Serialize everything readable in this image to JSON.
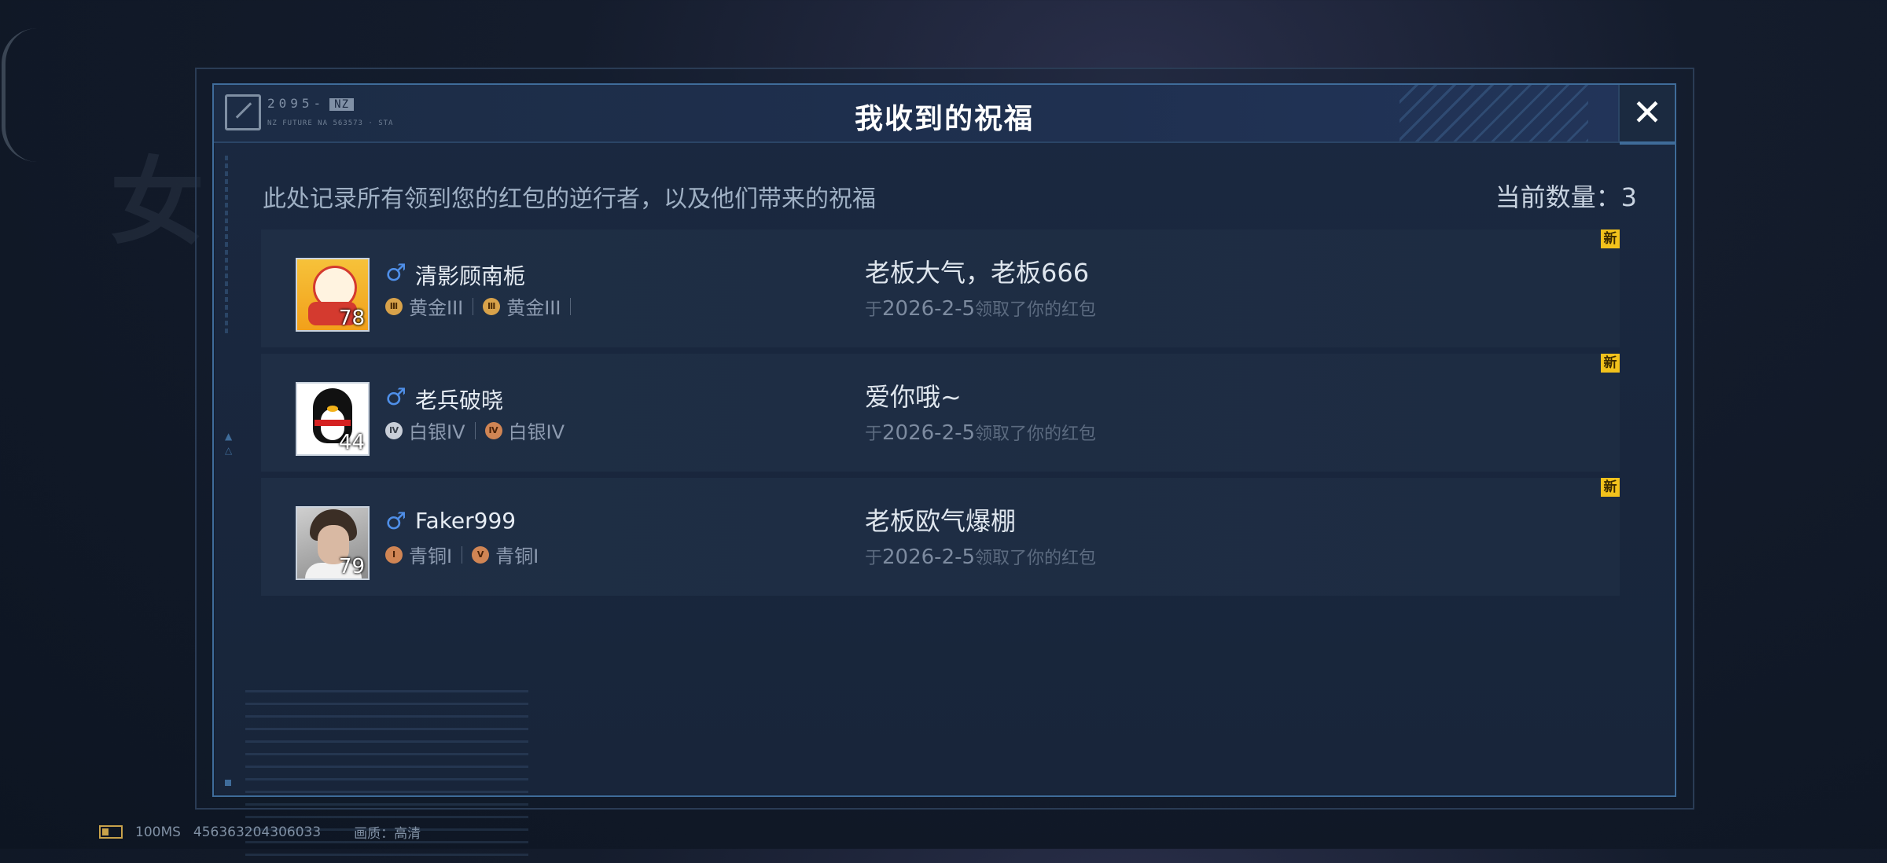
{
  "dialog": {
    "title": "我收到的祝福",
    "logo_code": "2095-",
    "logo_tag": "NZ",
    "logo_sub": "NZ FUTURE NA 563573 · STA",
    "close_label": "✕",
    "description": "此处记录所有领到您的红包的逆行者，以及他们带来的祝福",
    "count_text": "当前数量：3"
  },
  "entries": [
    {
      "name": "清影顾南栀",
      "gender": "♂",
      "level": "78",
      "rank1_icon": "Ⅲ",
      "rank1": "黄金III",
      "rank2_icon": "Ⅲ",
      "rank2": "黄金III",
      "blessing": "老板大气，老板666",
      "prefix": "于",
      "date": "2026-2-5",
      "suffix": "领取了你的红包",
      "badge": "新"
    },
    {
      "name": "老兵破晓",
      "gender": "♂",
      "level": "44",
      "rank1_icon": "Ⅳ",
      "rank1": "白银IV",
      "rank2_icon": "Ⅳ",
      "rank2": "白银IV",
      "blessing": "爱你哦~",
      "prefix": "于",
      "date": "2026-2-5",
      "suffix": "领取了你的红包",
      "badge": "新"
    },
    {
      "name": "Faker999",
      "gender": "♂",
      "level": "79",
      "rank1_icon": "Ⅰ",
      "rank1": "青铜I",
      "rank2_icon": "Ⅴ",
      "rank2": "青铜I",
      "blessing": "老板欧气爆棚",
      "prefix": "于",
      "date": "2026-2-5",
      "suffix": "领取了你的红包",
      "badge": "新"
    }
  ],
  "status_bar": {
    "ping": "100MS",
    "id": "456363204306033",
    "quality": "画质：高清"
  }
}
